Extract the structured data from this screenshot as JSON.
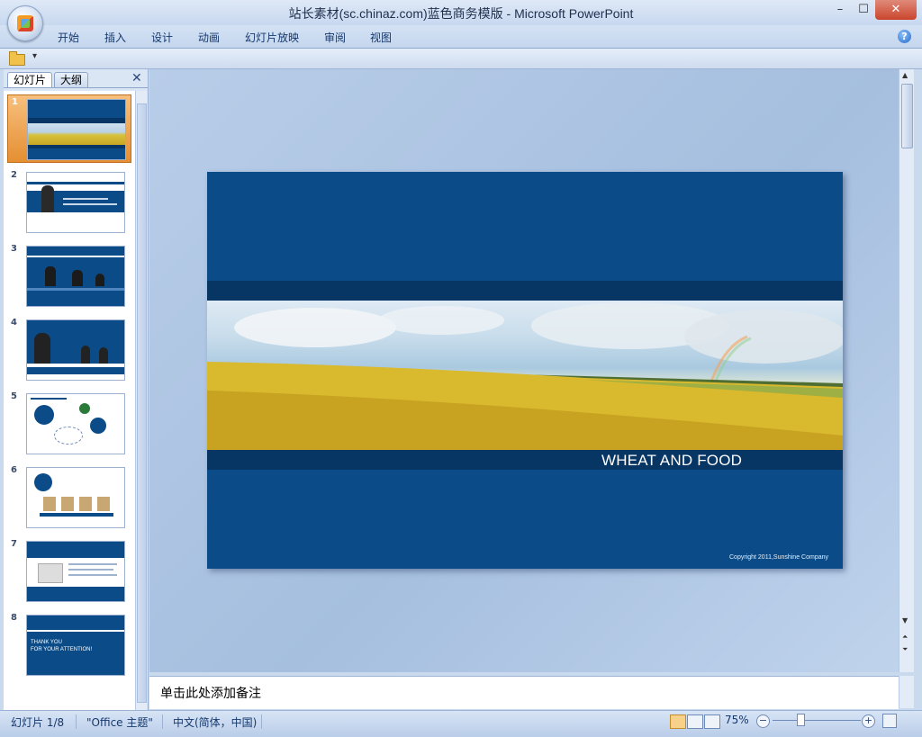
{
  "window": {
    "title": "站长素材(sc.chinaz.com)蓝色商务模版 - Microsoft PowerPoint",
    "min_glyph": "–",
    "max_glyph": "☐",
    "close_glyph": "✕"
  },
  "ribbon": {
    "tabs": [
      "开始",
      "插入",
      "设计",
      "动画",
      "幻灯片放映",
      "审阅",
      "视图"
    ],
    "help_glyph": "?"
  },
  "qat": {
    "dropdown_glyph": "▾"
  },
  "panel": {
    "tab_slides": "幻灯片",
    "tab_outline": "大纲",
    "close_glyph": "✕",
    "slide_numbers": [
      "1",
      "2",
      "3",
      "4",
      "5",
      "6",
      "7",
      "8"
    ],
    "selected_slide": 1,
    "thumb8_line1": "THANK YOU",
    "thumb8_line2": "FOR YOUR ATTENTION!"
  },
  "slide": {
    "title": "WHEAT AND FOOD",
    "copyright": "Copyright 2011,Sunshine Company"
  },
  "notes": {
    "placeholder": "单击此处添加备注"
  },
  "status": {
    "slide_count": "幻灯片 1/8",
    "theme": "\"Office 主题\"",
    "language": "中文(简体，中国)",
    "zoom": "75%",
    "zoom_minus": "−",
    "zoom_plus": "+"
  },
  "colors": {
    "slide_bg": "#0b4c88",
    "slide_band": "#073564",
    "selected_thumb": "#e58f32"
  }
}
